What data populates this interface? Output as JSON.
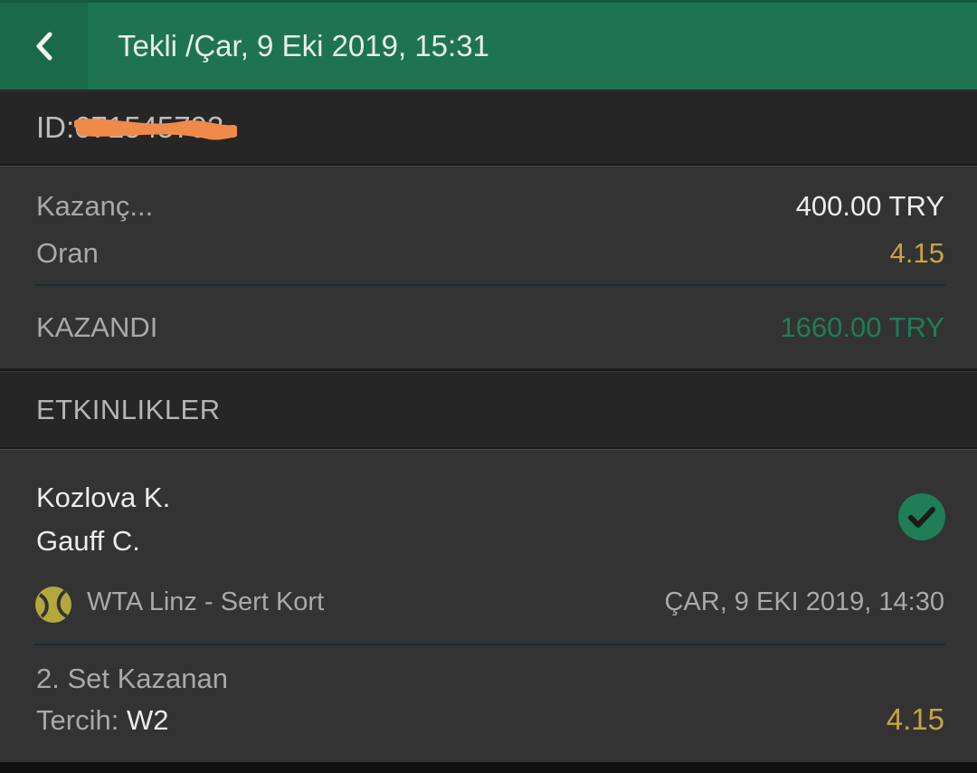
{
  "header": {
    "title": "Tekli /Çar, 9 Eki 2019, 15:31",
    "back_icon": "chevron-left-icon"
  },
  "bet": {
    "id_label": "ID:",
    "id_value": "671545793"
  },
  "summary": {
    "stake_label": "Kazanç...",
    "stake_value": "400.00 TRY",
    "odds_label": "Oran",
    "odds_value": "4.15",
    "result_label": "KAZANDI",
    "result_value": "1660.00 TRY"
  },
  "events": {
    "title": "ETKINLIKLER",
    "items": [
      {
        "home": "Kozlova K.",
        "away": "Gauff C.",
        "status_icon": "check-circle-icon",
        "league_icon": "tennis-ball-icon",
        "league": "WTA Linz - Sert Kort",
        "date": "ÇAR, 9 EKI 2019, 14:30",
        "market": "2. Set Kazanan",
        "pick_label": "Tercih:",
        "pick_value": "W2",
        "odds": "4.15"
      }
    ]
  },
  "colors": {
    "header_bg": "#1e7452",
    "odds_gold": "#c7a444",
    "win_green": "#1f7d57",
    "card_bg": "#333333"
  }
}
